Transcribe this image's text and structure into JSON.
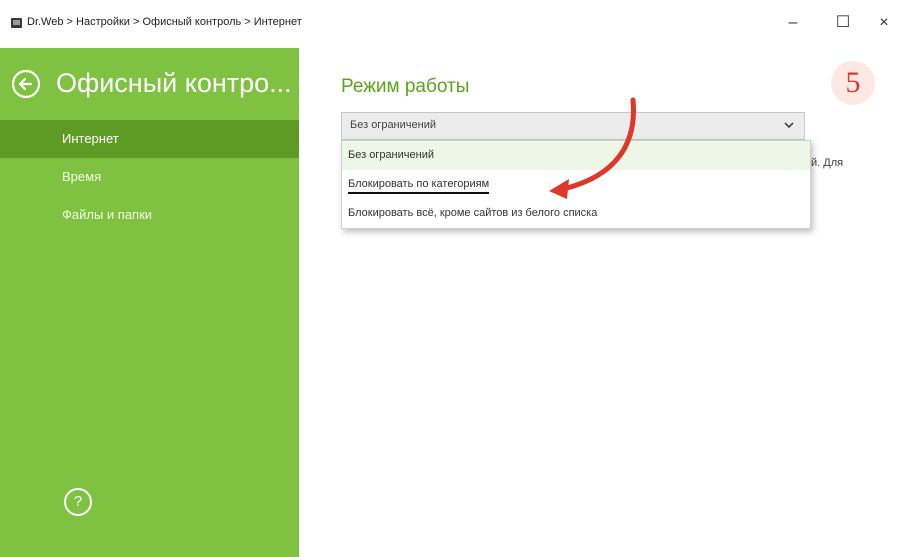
{
  "window": {
    "title": "Dr.Web > Настройки > Офисный контроль > Интернет",
    "minimize": "–",
    "maximize": "☐",
    "close": "×"
  },
  "sidebar": {
    "title": "Офисный контро...",
    "items": [
      {
        "label": "Интернет",
        "active": true
      },
      {
        "label": "Время",
        "active": false
      },
      {
        "label": "Файлы и папки",
        "active": false
      }
    ],
    "help": "?"
  },
  "main": {
    "section_title": "Режим работы",
    "step_badge": "5",
    "select": {
      "value": "Без ограничений",
      "options": [
        "Без ограничений",
        "Блокировать по категориям",
        "Блокировать всё, кроме сайтов из белого списка"
      ]
    },
    "clipped_text": "й. Для"
  },
  "colors": {
    "sidebar": "#7fc241",
    "active_nav": "#5e9b24",
    "accent_green": "#5aa51a",
    "annotation_red": "#e0372b"
  }
}
